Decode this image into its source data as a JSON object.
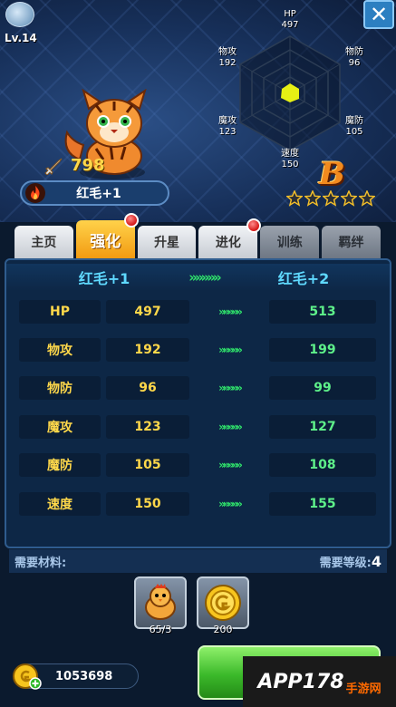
{
  "header": {
    "level": "Lv.14",
    "close_icon": "close-icon",
    "power": "798",
    "pet_name": "红毛+1",
    "grade": "B",
    "stars": 5
  },
  "radar": {
    "hp": {
      "label": "HP",
      "value": "497"
    },
    "patk": {
      "label": "物攻",
      "value": "192"
    },
    "pdef": {
      "label": "物防",
      "value": "96"
    },
    "matk": {
      "label": "魔攻",
      "value": "123"
    },
    "mdef": {
      "label": "魔防",
      "value": "105"
    },
    "speed": {
      "label": "速度",
      "value": "150"
    }
  },
  "tabs": [
    {
      "label": "主页"
    },
    {
      "label": "强化"
    },
    {
      "label": "升星"
    },
    {
      "label": "进化"
    },
    {
      "label": "训练"
    },
    {
      "label": "羁绊"
    }
  ],
  "compare": {
    "from": "红毛+1",
    "arrow": "»»»»»",
    "to": "红毛+2"
  },
  "stats": [
    {
      "label": "HP",
      "current": "497",
      "arrow": "»»»»»",
      "next": "513"
    },
    {
      "label": "物攻",
      "current": "192",
      "arrow": "»»»»»",
      "next": "199"
    },
    {
      "label": "物防",
      "current": "96",
      "arrow": "»»»»»",
      "next": "99"
    },
    {
      "label": "魔攻",
      "current": "123",
      "arrow": "»»»»»",
      "next": "127"
    },
    {
      "label": "魔防",
      "current": "105",
      "arrow": "»»»»»",
      "next": "108"
    },
    {
      "label": "速度",
      "current": "150",
      "arrow": "»»»»»",
      "next": "155"
    }
  ],
  "materials": {
    "title": "需要材料:",
    "req_level_label": "需要等级:",
    "req_level": "4",
    "items": [
      {
        "icon": "chicken-icon",
        "count": "65/3"
      },
      {
        "icon": "gold-coin-icon",
        "count": "200"
      }
    ]
  },
  "footer": {
    "gold": "1053698",
    "watermark": "APP178",
    "watermark_sub": "手游网"
  },
  "colors": {
    "accent": "#f29b12",
    "stat_gold": "#ffd84a",
    "stat_green": "#5ef18a",
    "header_cyan": "#5fd9ff"
  }
}
